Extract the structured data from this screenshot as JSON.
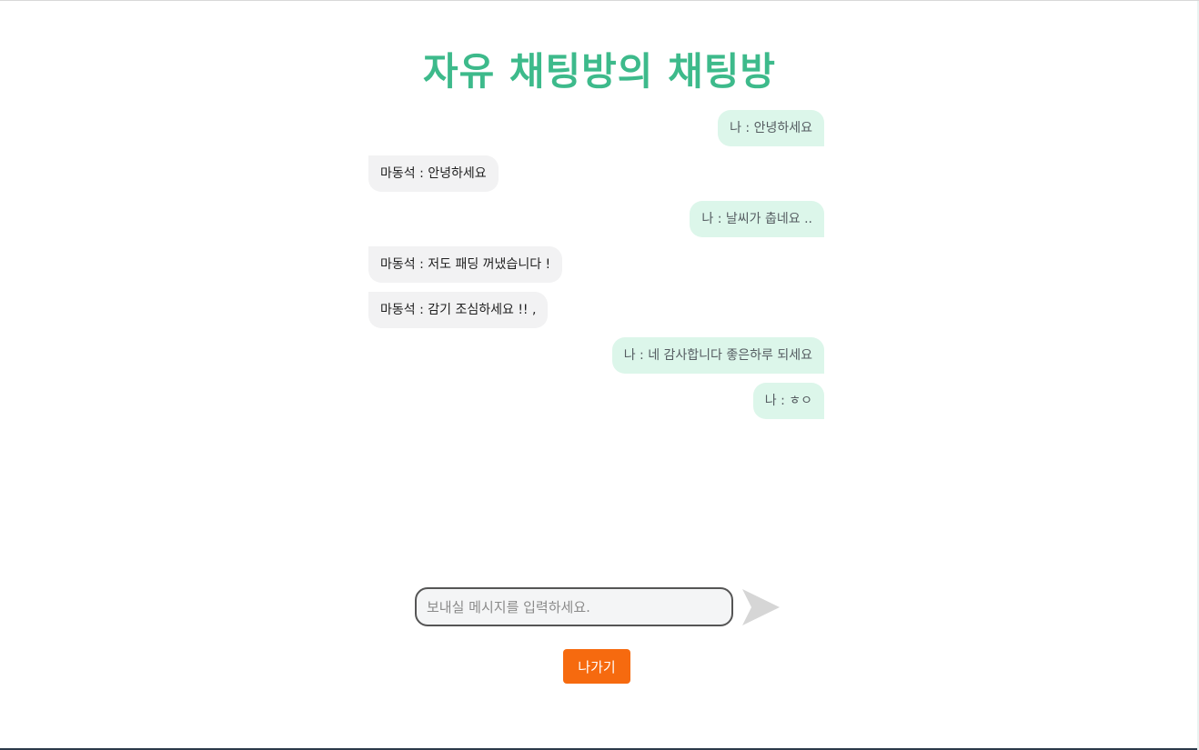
{
  "room": {
    "title": "자유 채팅방의 채팅방"
  },
  "messages": [
    {
      "sender": "나",
      "text": "나 : 안녕하세요",
      "mine": true
    },
    {
      "sender": "마동석",
      "text": "마동석 : 안녕하세요",
      "mine": false
    },
    {
      "sender": "나",
      "text": "나 : 날씨가 춥네요 ..",
      "mine": true
    },
    {
      "sender": "마동석",
      "text": "마동석 : 저도 패딩 꺼냈습니다 !",
      "mine": false
    },
    {
      "sender": "마동석",
      "text": "마동석 : 감기 조심하세요 !! ,",
      "mine": false
    },
    {
      "sender": "나",
      "text": "나 : 네 감사합니다 좋은하루 되세요",
      "mine": true
    },
    {
      "sender": "나",
      "text": "나 : ㅎㅇ",
      "mine": true
    }
  ],
  "composer": {
    "placeholder": "보내실 메시지를 입력하세요.",
    "value": "",
    "send_icon": "send-paper-plane-icon"
  },
  "actions": {
    "exit_label": "나가기"
  },
  "colors": {
    "title": "#3dba8b",
    "my_bubble": "#dcf6ea",
    "other_bubble": "#f2f2f3",
    "exit_button": "#f66a0f",
    "send_icon": "#d6d6d6"
  }
}
